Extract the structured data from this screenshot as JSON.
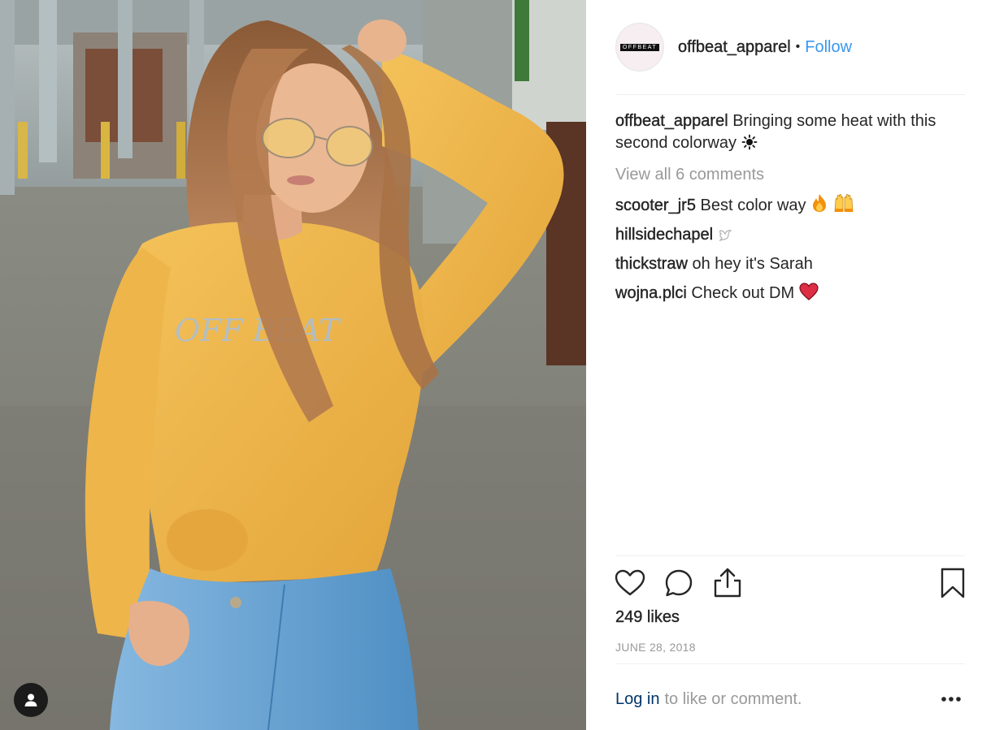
{
  "post": {
    "username": "offbeat_apparel",
    "follow_label": "Follow",
    "separator": "•",
    "avatar_text": "OFFBEAT",
    "caption_text": "Bringing some heat with this second colorway",
    "caption_emoji": "sun-emoji",
    "view_all_label": "View all 6 comments",
    "comments": [
      {
        "user": "scooter_jr5",
        "text": "Best color way",
        "emojis": [
          "fire-emoji",
          "raised-hands-emoji"
        ]
      },
      {
        "user": "hillsidechapel",
        "text": "",
        "emojis": [
          "dove-emoji"
        ]
      },
      {
        "user": "thickstraw",
        "text": "oh hey it's Sarah",
        "emojis": []
      },
      {
        "user": "wojna.plci",
        "text": "Check out DM",
        "emojis": [
          "heart-emoji"
        ]
      }
    ],
    "likes": "249 likes",
    "date": "JUNE 28, 2018",
    "login_label": "Log in",
    "login_rest": "to like or comment."
  },
  "icons": {
    "like": "heart-icon",
    "comment": "comment-icon",
    "share": "share-icon",
    "save": "bookmark-icon",
    "more": "more-options-icon",
    "tag": "user-tag-icon"
  },
  "colors": {
    "follow": "#3897f0",
    "muted": "#999999",
    "text": "#262626",
    "login": "#003569",
    "shirt": "#f1b84a",
    "jeans": "#6aa6d6"
  }
}
